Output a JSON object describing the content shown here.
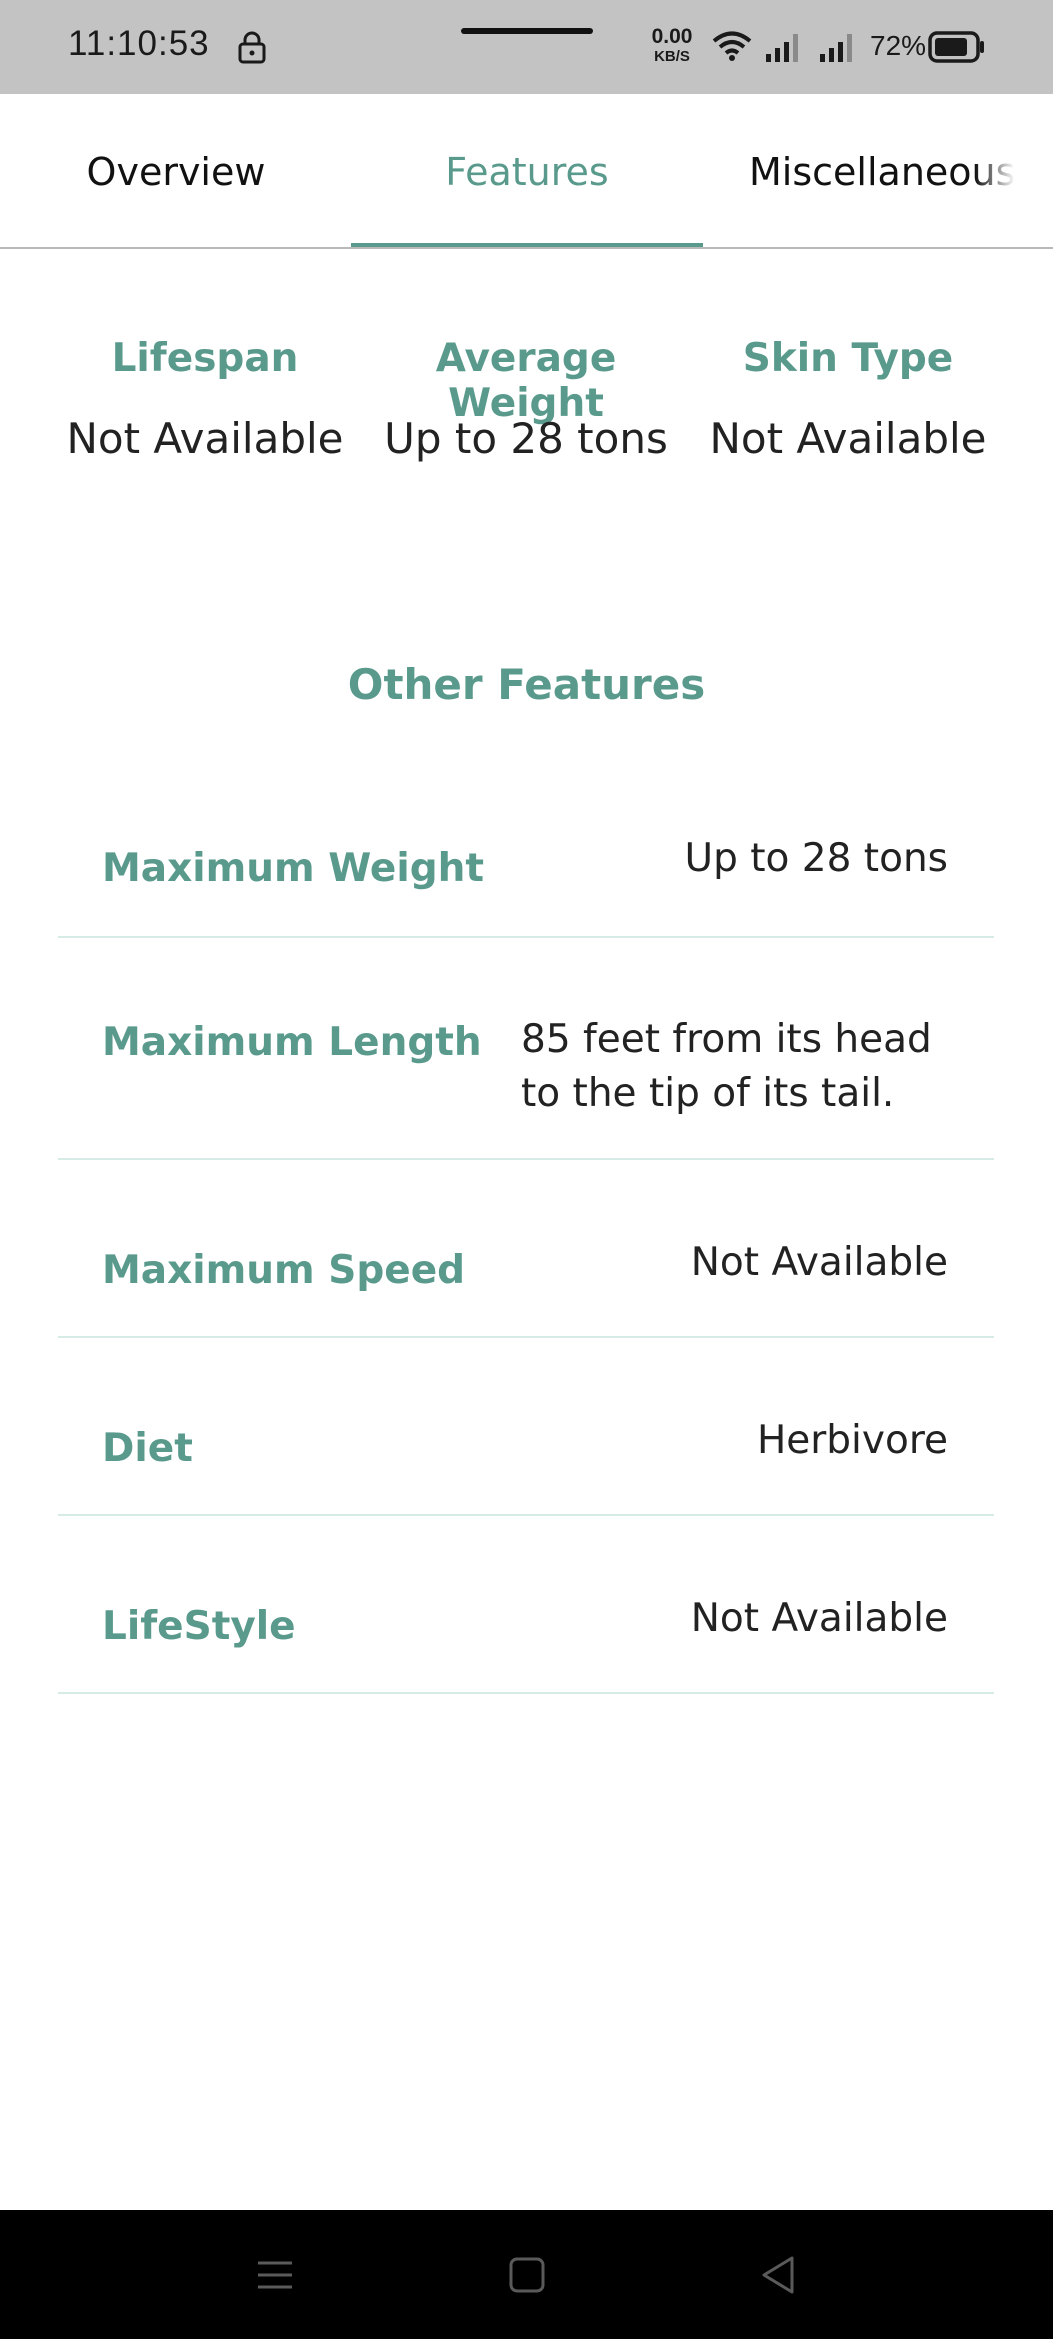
{
  "status_bar": {
    "time": "11:10:53",
    "net_speed_value": "0.00",
    "net_speed_unit": "KB/S",
    "battery": "72%"
  },
  "tabs": [
    {
      "label": "Overview",
      "active": false
    },
    {
      "label": "Features",
      "active": true
    },
    {
      "label": "Miscellaneous",
      "active": false
    }
  ],
  "summary": [
    {
      "label": "Lifespan",
      "value": "Not Available"
    },
    {
      "label": "Average Weight",
      "value": "Up to 28 tons"
    },
    {
      "label": "Skin Type",
      "value": "Not Available"
    }
  ],
  "other_features": {
    "title": "Other Features",
    "rows": [
      {
        "label": "Maximum Weight",
        "value": "Up to 28 tons"
      },
      {
        "label": "Maximum Length",
        "value": "85 feet from its head to the tip of its tail."
      },
      {
        "label": "Maximum Speed",
        "value": "Not Available"
      },
      {
        "label": "Diet",
        "value": "Herbivore"
      },
      {
        "label": "LifeStyle",
        "value": "Not Available"
      }
    ]
  },
  "colors": {
    "accent": "#5a9a8c",
    "divider": "#d6ebe6",
    "status_bar_bg": "#c3c3c3",
    "nav_bar_bg": "#000000"
  },
  "icons": [
    "lock-icon",
    "wifi-icon",
    "signal-icon",
    "battery-icon",
    "menu-icon",
    "home-icon",
    "back-icon"
  ]
}
